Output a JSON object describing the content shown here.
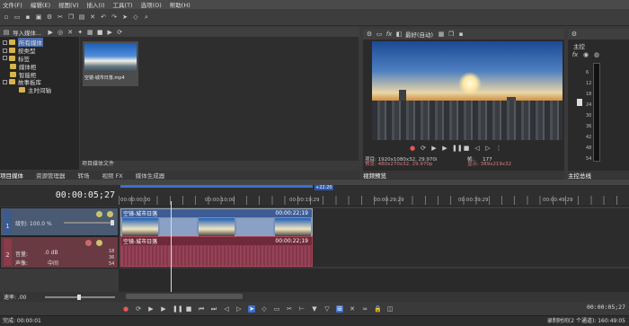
{
  "menu": [
    "文件(F)",
    "编辑(E)",
    "视图(V)",
    "插入(I)",
    "工具(T)",
    "选项(O)",
    "帮助(H)"
  ],
  "explorer": {
    "import_label": "导入媒体...",
    "tree": [
      {
        "label": "所有媒体",
        "level": 0,
        "selected": true
      },
      {
        "label": "按类型",
        "level": 0
      },
      {
        "label": "标签",
        "level": 0
      },
      {
        "label": "媒体柜",
        "level": 1
      },
      {
        "label": "智能柜",
        "level": 1
      },
      {
        "label": "故事板库",
        "level": 0
      },
      {
        "label": "主时间轴",
        "level": 2
      }
    ],
    "media_item": "空镜-城市日落.mp4",
    "footer": "项目媒体文件"
  },
  "left_tabs": [
    "项目媒体",
    "资源管理器",
    "转场",
    "视频 FX",
    "媒体生成器"
  ],
  "preview": {
    "mode": "最好(自动)",
    "project": "项目: 1920x1080x32, 29.970i",
    "preview_res": "预览: 480x270x32, 29.970p",
    "frame": "帧:",
    "frame_value": "177",
    "display": "显示:",
    "display_value": "389x219x32",
    "tab": "视频预览"
  },
  "master": {
    "label": "主控",
    "tab": "主控总线",
    "meter_ticks": [
      "6",
      "12",
      "18",
      "24",
      "30",
      "36",
      "42",
      "48",
      "54"
    ],
    "meter_level": 0
  },
  "timeline": {
    "timecode": "00:00:05;27",
    "region_end": "+22:20",
    "ruler": [
      "00:00:00;00",
      "00:00:10;00",
      "00:00:19;29",
      "00:00:29;29",
      "00:00:39;29",
      "00:00:49;29"
    ],
    "video_clip": {
      "name": "空镜-城市日落",
      "duration": "00:00:22;19"
    },
    "audio_clip": {
      "name": "空镜-城市日落",
      "duration": "00:00:22;19"
    },
    "video_track": {
      "num": "1",
      "level": "级别: 100.0 %"
    },
    "audio_track": {
      "num": "2",
      "volume_label": "音量:",
      "volume": ".0 dB",
      "pan_label": "声像:",
      "pan": "中间",
      "db_marks": [
        "18",
        "36",
        "54"
      ]
    },
    "rate": "速率: .00",
    "end_timecode": "00:00:05;27"
  },
  "status": {
    "left": "完成: 00:00:01",
    "right": "录制时间(2 个通道): 160:49:05"
  }
}
